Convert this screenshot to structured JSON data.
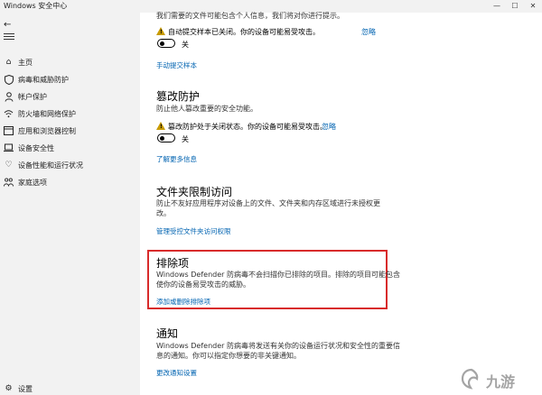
{
  "window": {
    "title": "Windows 安全中心",
    "controls": {
      "minimize": "—",
      "maximize": "☐",
      "close": "✕"
    }
  },
  "sidebar": {
    "back_icon": "back-arrow-icon",
    "menu_icon": "hamburger-menu-icon",
    "items": [
      {
        "label": "主页",
        "icon": "home-icon"
      },
      {
        "label": "病毒和威胁防护",
        "icon": "shield-icon"
      },
      {
        "label": "帐户保护",
        "icon": "person-icon"
      },
      {
        "label": "防火墙和网络保护",
        "icon": "wifi-icon"
      },
      {
        "label": "应用和浏览器控制",
        "icon": "app-window-icon"
      },
      {
        "label": "设备安全性",
        "icon": "laptop-icon"
      },
      {
        "label": "设备性能和运行状况",
        "icon": "heart-icon"
      },
      {
        "label": "家庭选项",
        "icon": "family-icon"
      }
    ],
    "settings": {
      "label": "设置",
      "icon": "gear-icon"
    }
  },
  "sample_submission": {
    "desc": "我们需要的文件可能包含个人信息，我们将对你进行提示。",
    "warning": "自动提交样本已关闭。你的设备可能易受攻击。",
    "dismiss": "忽略",
    "toggle_state": "关",
    "link": "手动提交样本"
  },
  "tamper_protection": {
    "title": "篡改防护",
    "desc": "防止他人篡改重要的安全功能。",
    "warning": "篡改防护处于关闭状态。你的设备可能易受攻击。",
    "dismiss": "忽略",
    "toggle_state": "关",
    "link": "了解更多信息"
  },
  "folder_access": {
    "title": "文件夹限制访问",
    "desc_line1": "防止不友好应用程序对设备上的文件、文件夹和内存区域进行未授权更",
    "desc_line2": "改。",
    "link": "管理受控文件夹访问权限"
  },
  "exclusions": {
    "title": "排除项",
    "desc_line1": "Windows Defender 防病毒不会扫描你已排除的项目。排除的项目可能包含",
    "desc_line2": "使你的设备易受攻击的威胁。",
    "link": "添加或删除排除项"
  },
  "notifications": {
    "title": "通知",
    "desc_line1": "Windows Defender 防病毒将发送有关你的设备运行状况和安全性的重要信",
    "desc_line2": "息的通知。你可以指定你想要的非关键通知。",
    "link": "更改通知设置"
  },
  "watermark": {
    "text": "九游",
    "icon": "jiuyou-logo-icon"
  },
  "colors": {
    "link": "#0063b1",
    "warning": "#c79a00",
    "highlight": "#d82b2b",
    "sidebar_bg": "#f2f2f2"
  }
}
